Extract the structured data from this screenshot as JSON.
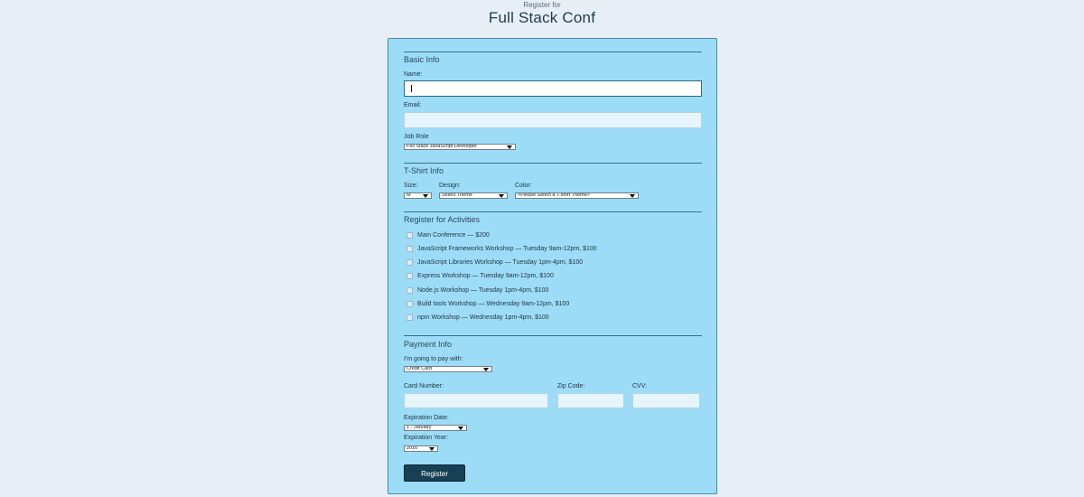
{
  "header": {
    "subtitle": "Register for",
    "title": "Full Stack Conf"
  },
  "basic": {
    "legend": "Basic Info",
    "name_label": "Name:",
    "name_value": "",
    "email_label": "Email:",
    "email_value": "",
    "job_label": "Job Role",
    "job_selected": "Full Stack JavaScript Developer"
  },
  "shirt": {
    "legend": "T-Shirt Info",
    "size_label": "Size:",
    "size_selected": "M",
    "design_label": "Design:",
    "design_selected": "Select Theme",
    "color_label": "Color:",
    "color_selected": "<Please Select a T-shirt Theme>"
  },
  "activities": {
    "legend": "Register for Activities",
    "items": [
      "Main Conference — $200",
      "JavaScript Frameworks Workshop — Tuesday 9am-12pm, $100",
      "JavaScript Libraries Workshop — Tuesday 1pm-4pm, $100",
      "Express Workshop — Tuesday 9am-12pm, $100",
      "Node.js Workshop — Tuesday 1pm-4pm, $100",
      "Build tools Workshop — Wednesday 9am-12pm, $100",
      "npm Workshop — Wednesday 1pm-4pm, $100"
    ]
  },
  "payment": {
    "legend": "Payment Info",
    "pay_label": "I'm going to pay with:",
    "pay_selected": "Credit Card",
    "card_label": "Card Number:",
    "zip_label": "Zip Code:",
    "cvv_label": "CVV:",
    "exp_date_label": "Expiration Date:",
    "exp_date_selected": "1 - January",
    "exp_year_label": "Expiration Year:",
    "exp_year_selected": "2016"
  },
  "submit": {
    "label": "Register"
  },
  "colors": {
    "page_bg": "#e7eef5",
    "form_bg": "#9ddcf6",
    "button_bg": "#173f56"
  }
}
